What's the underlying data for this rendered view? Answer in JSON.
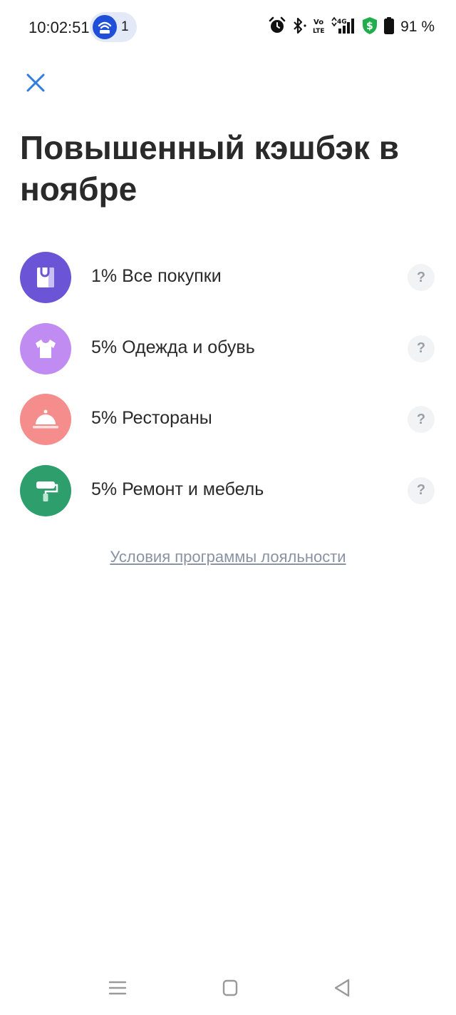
{
  "status_bar": {
    "time": "10:02:51",
    "hotspot_count": "1",
    "battery": "91 %",
    "icons": [
      "hotspot-icon",
      "alarm-icon",
      "bluetooth-icon",
      "volte-icon",
      "signal-icon",
      "shield-dollar-icon",
      "battery-icon"
    ],
    "volte_label": "Vo\nLTE",
    "network_label": "4G"
  },
  "header": {
    "title": "Повышенный кэшбэк в ноябре"
  },
  "cashback": {
    "items": [
      {
        "label": "1% Все покупки",
        "icon": "shopping-bag-icon",
        "color": "#6b55d6"
      },
      {
        "label": "5% Одежда и обувь",
        "icon": "tshirt-icon",
        "color": "#c08cf2"
      },
      {
        "label": "5% Рестораны",
        "icon": "cloche-icon",
        "color": "#f58d8d"
      },
      {
        "label": "5% Ремонт и мебель",
        "icon": "paint-roller-icon",
        "color": "#2e9e6c"
      }
    ],
    "help_label": "?"
  },
  "footer": {
    "loyalty_link": "Условия программы лояльности"
  },
  "colors": {
    "accent": "#2f7de1",
    "title": "#2a2a2a",
    "link": "#8a93a3"
  }
}
